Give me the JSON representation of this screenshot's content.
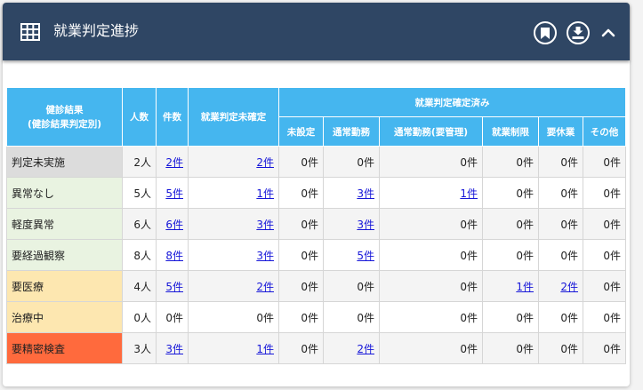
{
  "header": {
    "title": "就業判定進捗"
  },
  "table": {
    "col_group_result": "健診結果\n(健診結果判定別)",
    "col_persons": "人数",
    "col_count": "件数",
    "col_undetermined": "就業判定未確定",
    "col_group_determined": "就業判定確定済み",
    "sub_headers": [
      "未設定",
      "通常勤務",
      "通常勤務(要管理)",
      "就業制限",
      "要休業",
      "その他"
    ],
    "rows": [
      {
        "label": "判定未実施",
        "persons": "2人",
        "count": "2件",
        "undetermined": "2件",
        "cells": [
          "0件",
          "0件",
          "0件",
          "0件",
          "0件",
          "0件"
        ]
      },
      {
        "label": "異常なし",
        "persons": "5人",
        "count": "5件",
        "undetermined": "1件",
        "cells": [
          "0件",
          "3件",
          "1件",
          "0件",
          "0件",
          "0件"
        ]
      },
      {
        "label": "軽度異常",
        "persons": "6人",
        "count": "6件",
        "undetermined": "3件",
        "cells": [
          "0件",
          "3件",
          "0件",
          "0件",
          "0件",
          "0件"
        ]
      },
      {
        "label": "要経過観察",
        "persons": "8人",
        "count": "8件",
        "undetermined": "3件",
        "cells": [
          "0件",
          "5件",
          "0件",
          "0件",
          "0件",
          "0件"
        ]
      },
      {
        "label": "要医療",
        "persons": "4人",
        "count": "5件",
        "undetermined": "2件",
        "cells": [
          "0件",
          "0件",
          "0件",
          "1件",
          "2件",
          "0件"
        ]
      },
      {
        "label": "治療中",
        "persons": "0人",
        "count": "0件",
        "undetermined": "0件",
        "cells": [
          "0件",
          "0件",
          "0件",
          "0件",
          "0件",
          "0件"
        ]
      },
      {
        "label": "要精密検査",
        "persons": "3人",
        "count": "3件",
        "undetermined": "1件",
        "cells": [
          "0件",
          "2件",
          "0件",
          "0件",
          "0件",
          "0件"
        ]
      }
    ]
  },
  "icons": {
    "table": "table-icon",
    "bookmark": "bookmark-icon",
    "download": "download-icon",
    "collapse": "chevron-up-icon"
  },
  "colors": {
    "header_bg": "#2f4664",
    "th_bg": "#45b6ef",
    "link": "#1515d8",
    "row_gray": "#dcdcdc",
    "row_green": "#e9f3e1",
    "row_yellow": "#fde7b0",
    "row_orange": "#ff6a3d"
  }
}
